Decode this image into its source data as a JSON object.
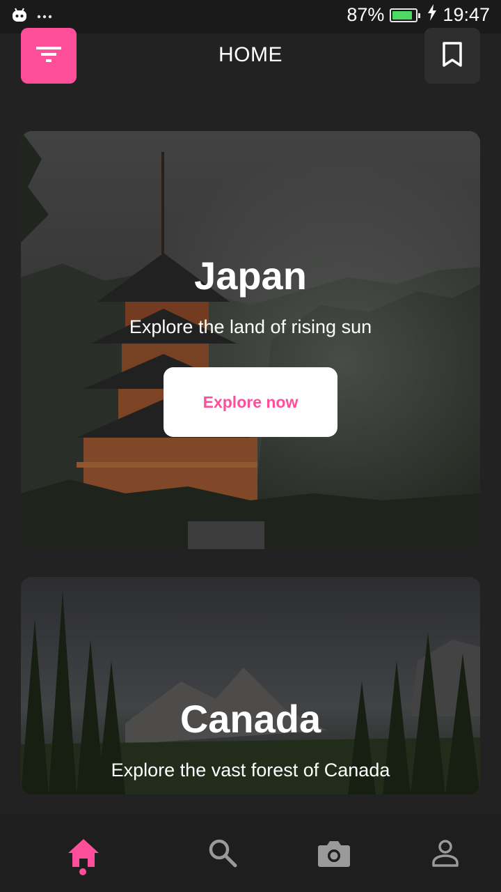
{
  "status_bar": {
    "battery_percent": "87%",
    "battery_level": 0.87,
    "time": "19:47",
    "icons": [
      "android-icon",
      "more-dots-icon",
      "battery-icon",
      "charging-icon"
    ]
  },
  "app_bar": {
    "title": "HOME",
    "left_icon": "filter-icon",
    "right_icon": "bookmark-icon"
  },
  "cards": [
    {
      "title": "Japan",
      "subtitle": "Explore the land of rising sun",
      "button_label": "Explore now"
    },
    {
      "title": "Canada",
      "subtitle": "Explore the vast forest of Canada"
    }
  ],
  "bottom_nav": {
    "items": [
      "home-icon",
      "search-icon",
      "camera-icon",
      "profile-icon"
    ],
    "active": "home"
  },
  "colors": {
    "accent": "#ff4f9a",
    "background": "#222222",
    "nav_inactive": "#9a9a9a"
  }
}
